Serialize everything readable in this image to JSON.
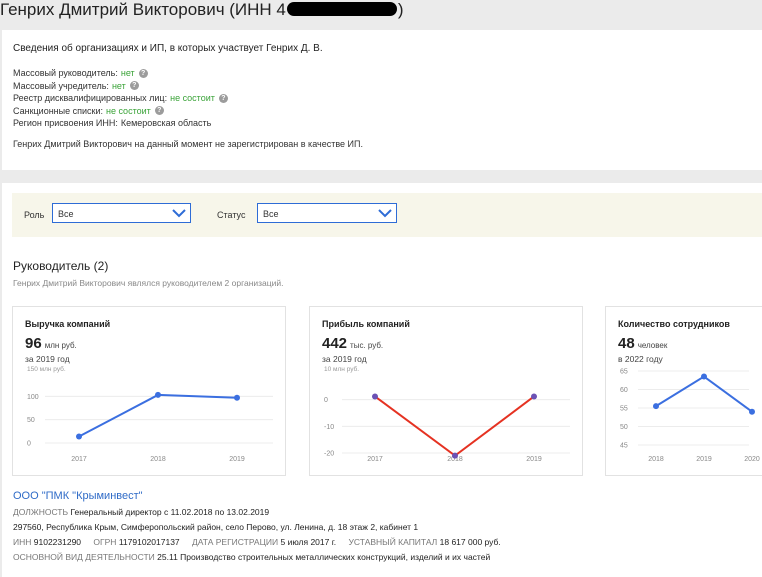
{
  "page": {
    "title_prefix": "Генрих Дмитрий Викторович (ИНН 4",
    "title_suffix": ")"
  },
  "info": {
    "heading": "Сведения об организациях и ИП, в которых участвует Генрих Д. В.",
    "rows": [
      {
        "label": "Массовый руководитель:",
        "value": "нет"
      },
      {
        "label": "Массовый учредитель:",
        "value": "нет"
      },
      {
        "label": "Реестр дисквалифицированных лиц:",
        "value": "не состоит"
      },
      {
        "label": "Санкционные списки:",
        "value": "не состоит"
      },
      {
        "label": "Регион присвоения ИНН:",
        "value": "Кемеровская область"
      }
    ],
    "note": "Генрих Дмитрий Викторович на данный момент не зарегистрирован в качестве ИП."
  },
  "filters": {
    "role_label": "Роль",
    "role_value": "Все",
    "status_label": "Статус",
    "status_value": "Все"
  },
  "section": {
    "title": "Руководитель (2)",
    "subtitle": "Генрих Дмитрий Викторович являлся руководителем 2 организаций."
  },
  "cards": [
    {
      "title": "Выручка компаний",
      "value": "96",
      "unit": "млн руб.",
      "period": "за 2019 год"
    },
    {
      "title": "Прибыль компаний",
      "value": "442",
      "unit": "тыс. руб.",
      "period": "за 2019 год"
    },
    {
      "title": "Количество сотрудников",
      "value": "48",
      "unit": "человек",
      "period": "в 2022 году"
    }
  ],
  "chart_data": [
    {
      "type": "line",
      "unit_label": "150 млн руб.",
      "x": [
        "2017",
        "2018",
        "2019"
      ],
      "y_ticks": [
        "100",
        "50",
        "0"
      ],
      "ylim": [
        0,
        150
      ],
      "series": [
        {
          "values": [
            14,
            103,
            97
          ],
          "color": "#3b6fe0"
        }
      ]
    },
    {
      "type": "line",
      "unit_label": "10 млн руб.",
      "x": [
        "2017",
        "2018",
        "2019"
      ],
      "y_ticks": [
        "0",
        "-10",
        "-20"
      ],
      "ylim": [
        -20,
        10
      ],
      "series": [
        {
          "values": [
            1.2,
            -21,
            1.2
          ],
          "color": "#e53222"
        }
      ]
    },
    {
      "type": "line",
      "x": [
        "2018",
        "2019",
        "2020"
      ],
      "y_ticks": [
        "65",
        "60",
        "55",
        "50",
        "45"
      ],
      "ylim": [
        45,
        65
      ],
      "series": [
        {
          "values": [
            55.5,
            63.5,
            54
          ],
          "color": "#3b6fe0"
        }
      ]
    }
  ],
  "company": {
    "name": "ООО \"ПМК \"Крыминвест\"",
    "position_label": "ДОЛЖНОСТЬ",
    "position_value": "Генеральный директор",
    "position_dates": "с 11.02.2018 по 13.02.2019",
    "address": "297560, Республика Крым, Симферопольский район, село Перово, ул. Ленина, д. 18 этаж 2, кабинет 1",
    "inn_label": "ИНН",
    "inn_value": "9102231290",
    "ogrn_label": "ОГРН",
    "ogrn_value": "1179102017137",
    "reg_label": "ДАТА РЕГИСТРАЦИИ",
    "reg_value": "5 июля 2017 г.",
    "capital_label": "УСТАВНЫЙ КАПИТАЛ",
    "capital_value": "18 617 000 руб.",
    "activity_label": "ОСНОВНОЙ ВИД ДЕЯТЕЛЬНОСТИ",
    "activity_value": "25.11 Производство строительных металлических конструкций, изделий и их частей"
  }
}
